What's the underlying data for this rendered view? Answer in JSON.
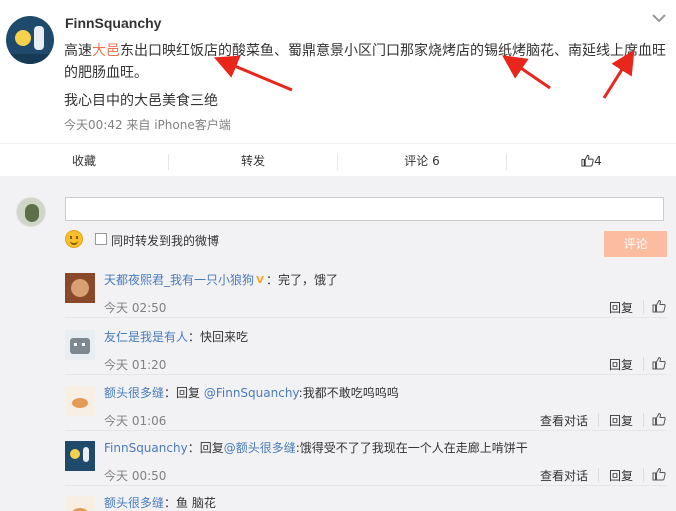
{
  "post": {
    "username": "FinnSquanchy",
    "text_segments": {
      "s1": "高速",
      "s2": "大邑",
      "s3": "东出口映红饭店的酸菜鱼、蜀鼎意景小区门口那家烧烤店的锡纸烤脑花、南延线上席血旺"
    },
    "text_line2": "的肥肠血旺。",
    "text_line3": "我心目中的大邑美食三绝",
    "meta": "今天00:42 来自 iPhone客户端"
  },
  "actions": {
    "favorite": "收藏",
    "repost": "转发",
    "comment": "评论 6",
    "like_count": "4"
  },
  "composer": {
    "input_value": "",
    "forward_label": "同时转发到我的微博",
    "submit_label": "评论"
  },
  "comments": [
    {
      "name": "天都夜熙君_我有一只小狼狗",
      "sep": "：",
      "text": "完了，饿了",
      "time": "今天 02:50",
      "reply": "回复",
      "conversation": ""
    },
    {
      "name": "友仁是我是有人",
      "sep": "：",
      "text": "快回来吃",
      "time": "今天 01:20",
      "reply": "回复",
      "conversation": ""
    },
    {
      "name": "额头很多缝",
      "sep": "：回复 ",
      "at": "@FinnSquanchy",
      "text": ":我都不敢吃呜呜呜",
      "time": "今天 01:06",
      "reply": "回复",
      "conversation": "查看对话"
    },
    {
      "name": "FinnSquanchy",
      "sep": "：回复",
      "at": "@额头很多缝",
      "text": ":饿得受不了了我现在一个人在走廊上啃饼干",
      "time": "今天 00:50",
      "reply": "回复",
      "conversation": "查看对话"
    },
    {
      "name": "额头很多缝",
      "sep": "：",
      "text": "鱼 脑花",
      "time": "",
      "reply": "",
      "conversation": ""
    }
  ],
  "colors": {
    "accent": "#eb7350",
    "link": "#4a7bb7",
    "annotation_arrow": "#e8261c",
    "submit_disabled": "#fbbc9f"
  }
}
